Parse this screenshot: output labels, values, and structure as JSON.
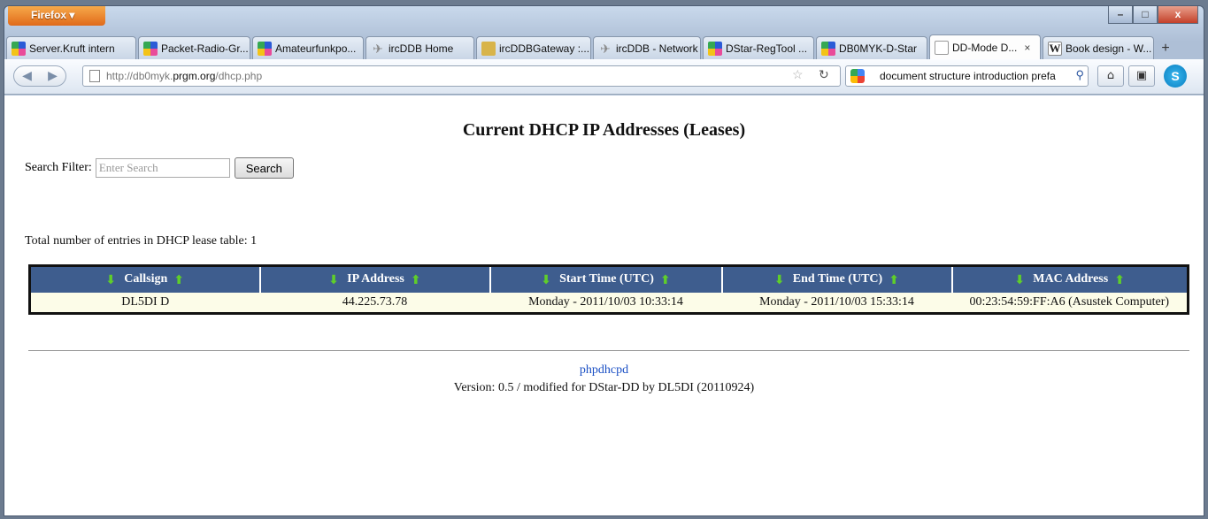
{
  "browser": {
    "menu_label": "Firefox ▾",
    "window_controls": {
      "minimize": "–",
      "maximize": "□",
      "close": "x"
    },
    "tabs": [
      {
        "label": "Server.Kruft intern",
        "icon": "mosaic-icon"
      },
      {
        "label": "Packet-Radio-Gr...",
        "icon": "mosaic-icon"
      },
      {
        "label": "Amateurfunkpo...",
        "icon": "mosaic-icon"
      },
      {
        "label": "ircDDB Home",
        "icon": "ircddb-icon"
      },
      {
        "label": "ircDDBGateway :...",
        "icon": "gateway-icon"
      },
      {
        "label": "ircDDB - Network",
        "icon": "ircddb-icon"
      },
      {
        "label": "DStar-RegTool ...",
        "icon": "mosaic-icon"
      },
      {
        "label": "DB0MYK-D-Star",
        "icon": "mosaic-icon"
      },
      {
        "label": "DD-Mode D...",
        "icon": "page-icon",
        "active": true,
        "close": "×"
      },
      {
        "label": "Book design - W...",
        "icon": "wikipedia-icon"
      }
    ],
    "new_tab": "+",
    "url": {
      "prefix": "http://db0myk.",
      "host": "prgm.org",
      "path": "/dhcp.php"
    },
    "search_text": "document structure introduction prefa"
  },
  "page": {
    "title": "Current DHCP IP Addresses (Leases)",
    "filter_label": "Search Filter:",
    "filter_placeholder": "Enter Search",
    "search_button": "Search",
    "total_text": "Total number of entries in DHCP lease table: 1",
    "columns": [
      "Callsign",
      "IP Address",
      "Start Time (UTC)",
      "End Time (UTC)",
      "MAC Address"
    ],
    "rows": [
      [
        "DL5DI D",
        "44.225.73.78",
        "Monday - 2011/10/03 10:33:14",
        "Monday - 2011/10/03 15:33:14",
        "00:23:54:59:FF:A6 (Asustek Computer)"
      ]
    ],
    "footer_link": "phpdhcpd",
    "footer_version": "Version: 0.5 / modified for DStar-DD by DL5DI (20110924)"
  }
}
